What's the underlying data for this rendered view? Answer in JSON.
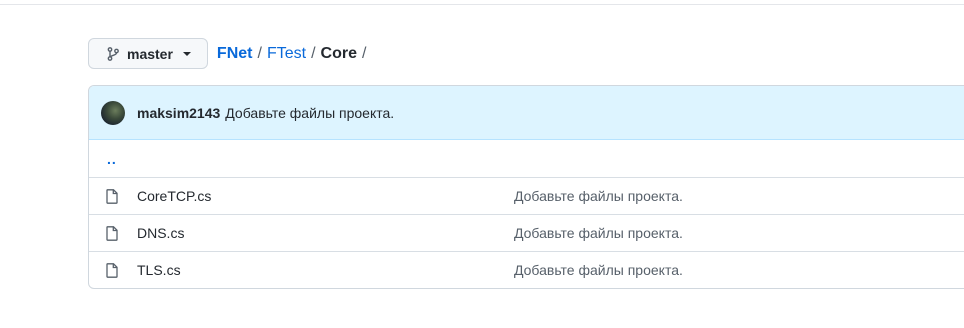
{
  "branch": {
    "name": "master"
  },
  "breadcrumb": {
    "repo": "FNet",
    "folder": "FTest",
    "current": "Core",
    "separator": "/"
  },
  "latest_commit": {
    "author": "maksim2143",
    "message": "Добавьте файлы проекта."
  },
  "parent_dir": "..",
  "files": [
    {
      "name": "CoreTCP.cs",
      "commit": "Добавьте файлы проекта.",
      "icon": "file-icon"
    },
    {
      "name": "DNS.cs",
      "commit": "Добавьте файлы проекта.",
      "icon": "file-icon"
    },
    {
      "name": "TLS.cs",
      "commit": "Добавьте файлы проекта.",
      "icon": "file-icon"
    }
  ],
  "colors": {
    "link": "#0969da",
    "commit_bg": "#ddf4ff",
    "border": "#d0d7de"
  }
}
